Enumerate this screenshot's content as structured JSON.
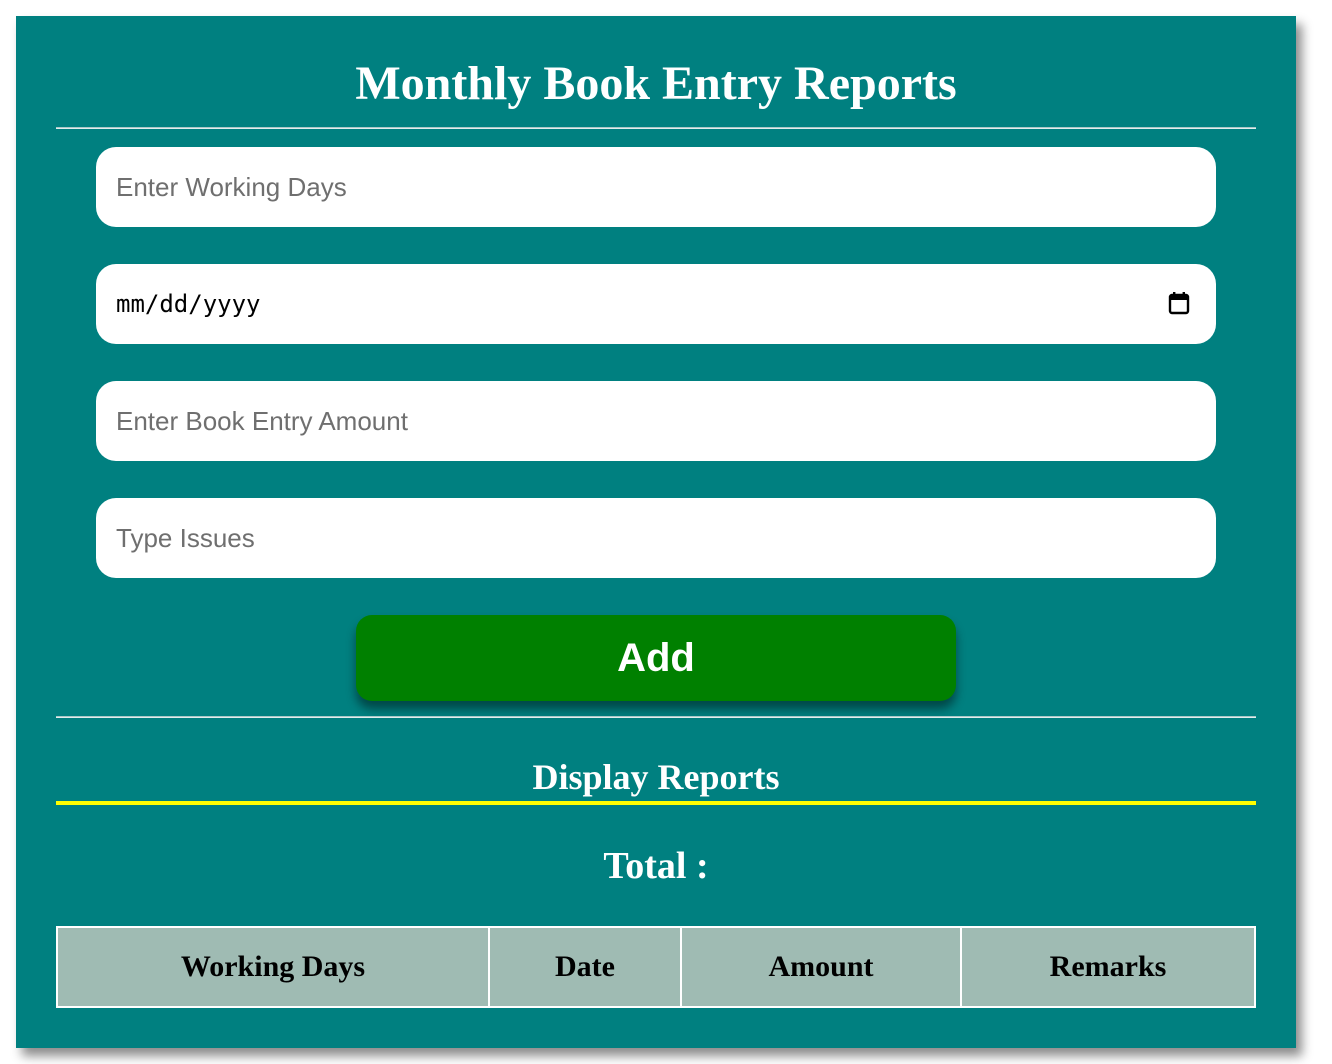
{
  "header": {
    "title": "Monthly Book Entry Reports"
  },
  "form": {
    "working_days_placeholder": "Enter Working Days",
    "date_placeholder": "mm/dd/yyyy",
    "amount_placeholder": "Enter Book Entry Amount",
    "issues_placeholder": "Type Issues",
    "add_label": "Add"
  },
  "reports": {
    "title": "Display Reports",
    "total_label": "Total :",
    "columns": [
      "Working Days",
      "Date",
      "Amount",
      "Remarks"
    ]
  },
  "colors": {
    "panel_bg": "#008080",
    "add_button_bg": "#008000",
    "accent_rule": "#ffff00",
    "table_header_bg": "#9fbbb3"
  },
  "icons": {
    "date_picker": "calendar-icon"
  }
}
